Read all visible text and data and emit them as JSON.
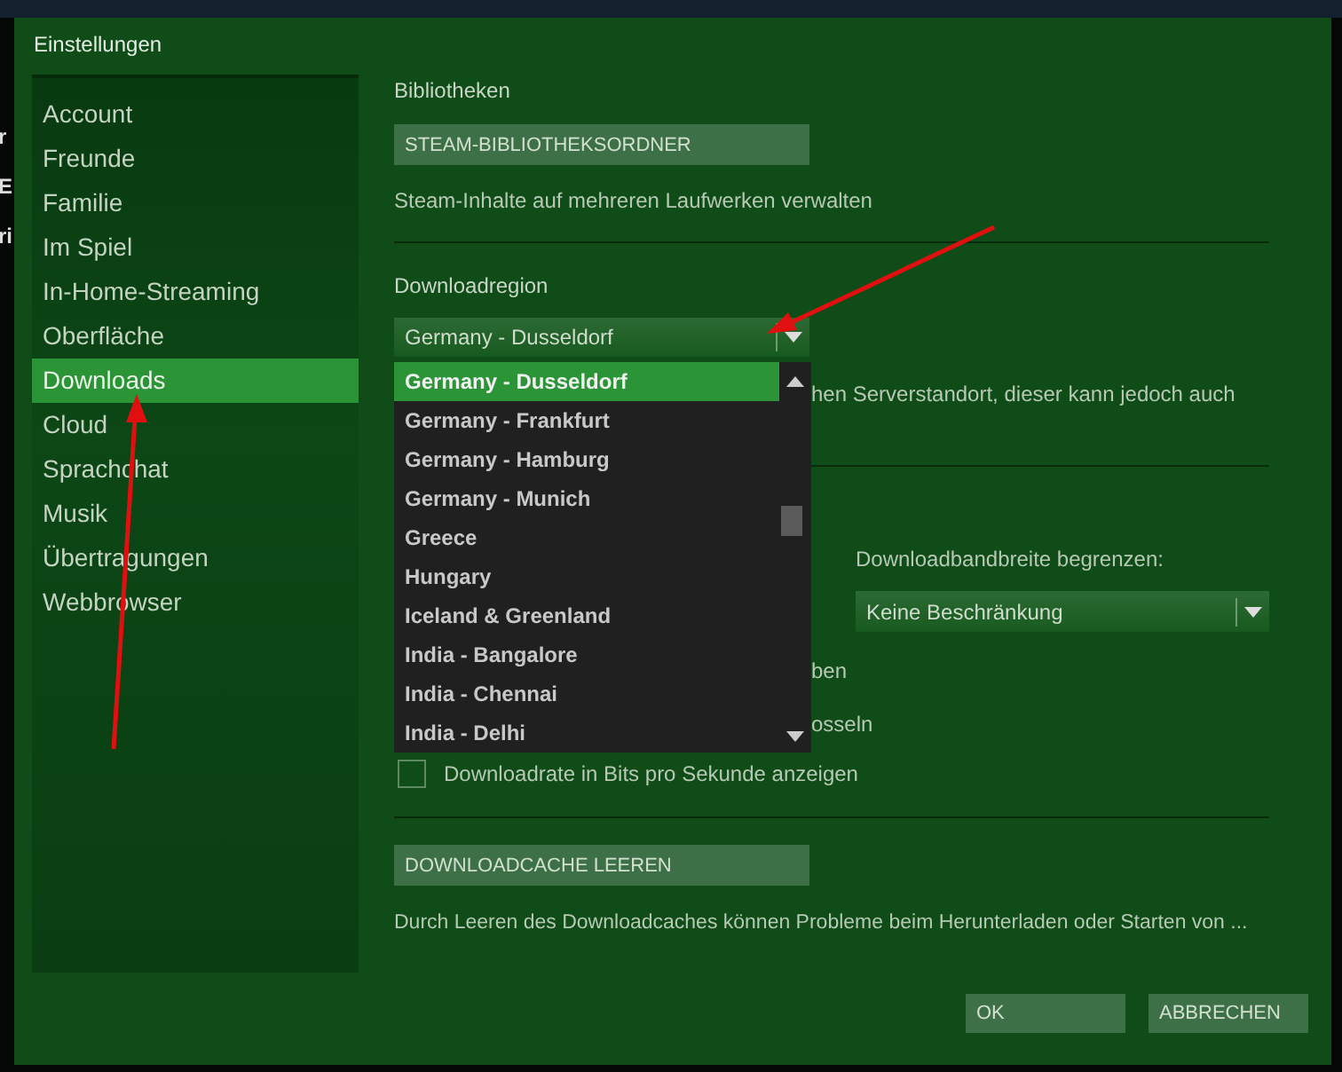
{
  "backdrop_fragments": [
    "r",
    "E",
    "ri"
  ],
  "window": {
    "title": "Einstellungen"
  },
  "sidebar": {
    "items": [
      {
        "label": "Account",
        "selected": false
      },
      {
        "label": "Freunde",
        "selected": false
      },
      {
        "label": "Familie",
        "selected": false
      },
      {
        "label": "Im Spiel",
        "selected": false
      },
      {
        "label": "In-Home-Streaming",
        "selected": false
      },
      {
        "label": "Oberfläche",
        "selected": false
      },
      {
        "label": "Downloads",
        "selected": true
      },
      {
        "label": "Cloud",
        "selected": false
      },
      {
        "label": "Sprachchat",
        "selected": false
      },
      {
        "label": "Musik",
        "selected": false
      },
      {
        "label": "Übertragungen",
        "selected": false
      },
      {
        "label": "Webbrowser",
        "selected": false
      }
    ]
  },
  "library": {
    "heading": "Bibliotheken",
    "button": "STEAM-BIBLIOTHEKSORDNER",
    "description": "Steam-Inhalte auf mehreren Laufwerken verwalten"
  },
  "download_region": {
    "heading": "Downloadregion",
    "value": "Germany - Dusseldorf",
    "description": "hen Serverstandort, dieser kann jedoch auch",
    "options": [
      {
        "label": "Germany - Dusseldorf",
        "selected": true
      },
      {
        "label": "Germany - Frankfurt",
        "selected": false
      },
      {
        "label": "Germany - Hamburg",
        "selected": false
      },
      {
        "label": "Germany - Munich",
        "selected": false
      },
      {
        "label": "Greece",
        "selected": false
      },
      {
        "label": "Hungary",
        "selected": false
      },
      {
        "label": "Iceland & Greenland",
        "selected": false
      },
      {
        "label": "India - Bangalore",
        "selected": false
      },
      {
        "label": "India - Chennai",
        "selected": false
      },
      {
        "label": "India - Delhi",
        "selected": false
      }
    ]
  },
  "bandwidth": {
    "label": "Downloadbandbreite begrenzen:",
    "value": "Keine Beschränkung"
  },
  "checkbox_rows": [
    {
      "label": "ben",
      "kind": "fragment"
    },
    {
      "label": "osseln",
      "kind": "fragment"
    },
    {
      "label": "Downloadrate in Bits pro Sekunde anzeigen",
      "kind": "checkbox",
      "checked": false
    }
  ],
  "cache": {
    "button": "DOWNLOADCACHE LEEREN",
    "description": "Durch Leeren des Downloadcaches können Probleme beim Herunterladen oder Starten von ..."
  },
  "buttons": [
    "OK",
    "ABBRECHEN"
  ]
}
